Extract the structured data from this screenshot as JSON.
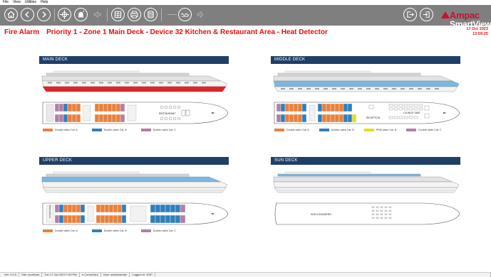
{
  "menu": {
    "file": "File",
    "view": "View",
    "utilities": "Utilities",
    "help": "Help"
  },
  "logo": {
    "brand": "Ampac",
    "product": "SmartView"
  },
  "alarm": {
    "type": "Fire Alarm",
    "message": "Priority 1 - Zone 1 Main Deck - Device 32 Kitchen & Restaurant Area - Heat Detector",
    "date": "17 Oct 2023",
    "time": "13:59:25"
  },
  "colors": {
    "alarm": "#e01010",
    "toolbar": "#7f7f7f",
    "deck_header": "#1f3f68",
    "cat_a": "#e9803b",
    "cat_b": "#2f7ebd",
    "cat_c": "#b07fa3",
    "prm": "#e3de1e"
  },
  "decks": {
    "main": {
      "title": "MAIN DECK",
      "plan_label": "RESTAURANT",
      "legend": [
        "Double cabin Cat. A",
        "Double cabin Cat. B",
        "Double cabin Cat. C"
      ]
    },
    "middle": {
      "title": "MIDDLE DECK",
      "plan_labels": [
        "LOUNGE / BAR",
        "RECEPTION"
      ],
      "legend": [
        "Double cabin Cat. A",
        "Double cabin Cat. B",
        "PRM cabin Cat. B",
        "Double cabin Cat. C"
      ]
    },
    "upper": {
      "title": "UPPER DECK",
      "plan_label": "FITNESS AREA",
      "legend": [
        "Double cabin Cat. A",
        "Double cabin Cat. B",
        "Double cabin Cat. C"
      ]
    },
    "sun": {
      "title": "SUN DECK",
      "plan_label": "SUN LOUNGERS"
    }
  },
  "toolbar_icons": [
    "home-icon",
    "back-icon",
    "forward-icon",
    "crosshair-icon",
    "alarm-icon",
    "mute-icon",
    "grid-icon",
    "printer-icon",
    "database-icon",
    "line-icon",
    "wave-icon",
    "sound-icon",
    "logout-icon",
    "login-icon"
  ],
  "status": {
    "version": "Ver: 9.0.5",
    "site": "Site: localhost",
    "timestamp": "Tue 17 Oct 2023 1:59 PM",
    "connection": "Connected",
    "user": "User: administrator",
    "logged": "Logged in: 1997"
  }
}
